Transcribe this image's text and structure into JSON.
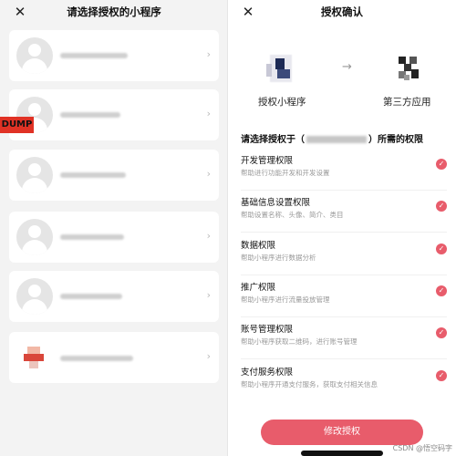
{
  "left": {
    "title": "请选择授权的小程序",
    "close_icon": "close-icon",
    "badge": "DUMP",
    "items": [
      {
        "avatar": "default-avatar"
      },
      {
        "avatar": "default-avatar"
      },
      {
        "avatar": "default-avatar"
      },
      {
        "avatar": "default-avatar"
      },
      {
        "avatar": "default-avatar"
      },
      {
        "avatar": "app-logo"
      }
    ]
  },
  "right": {
    "title": "授权确认",
    "close_icon": "close-icon",
    "source_label": "授权小程序",
    "target_label": "第三方应用",
    "arrow": "→",
    "question_prefix": "请选择授权于（",
    "question_suffix": "）所需的权限",
    "permissions": [
      {
        "title": "开发管理权限",
        "desc": "帮助进行功能开发和开发设置"
      },
      {
        "title": "基础信息设置权限",
        "desc": "帮助设置名称、头像、简介、类目"
      },
      {
        "title": "数据权限",
        "desc": "帮助小程序进行数据分析"
      },
      {
        "title": "推广权限",
        "desc": "帮助小程序进行流量投放管理"
      },
      {
        "title": "账号管理权限",
        "desc": "帮助小程序获取二维码，进行账号管理"
      },
      {
        "title": "支付服务权限",
        "desc": "帮助小程序开通支付服务，获取支付相关信息"
      }
    ],
    "button": "修改授权",
    "watermark": "CSDN @悟空码字"
  },
  "colors": {
    "accent": "#e85c6b",
    "badge": "#e03225"
  }
}
